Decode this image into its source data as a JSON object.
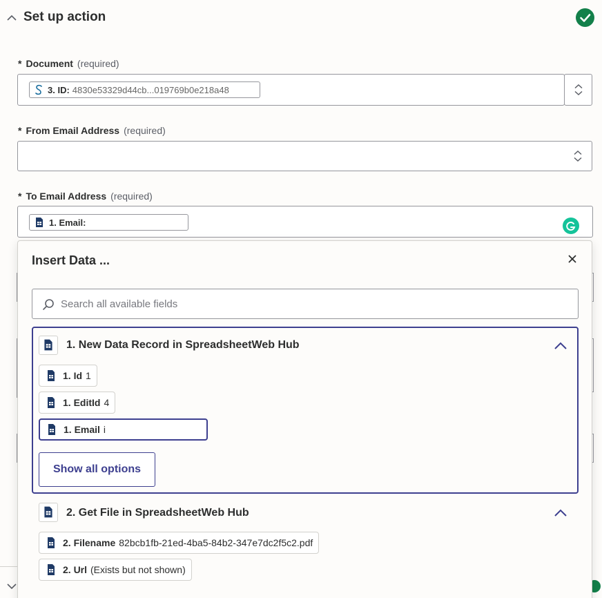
{
  "header": {
    "title": "Set up action",
    "status_color": "#13804a"
  },
  "fields": {
    "document": {
      "star": "*",
      "label": "Document",
      "required": "(required)",
      "pill_key": "3. ID:",
      "pill_value": "4830e53329d44cb...019769b0e218a48"
    },
    "from_email": {
      "star": "*",
      "label": "From Email Address",
      "required": "(required)",
      "value": ""
    },
    "to_email": {
      "star": "*",
      "label": "To Email Address",
      "required": "(required)",
      "pill_key": "1. Email:"
    }
  },
  "popup": {
    "title": "Insert Data ...",
    "search_placeholder": "Search all available fields",
    "groups": [
      {
        "title": "1. New Data Record in SpreadsheetWeb Hub",
        "expanded": true,
        "items": [
          {
            "key": "1. Id",
            "value": "1"
          },
          {
            "key": "1. EditId",
            "value": "4"
          },
          {
            "key": "1. Email",
            "value": "i",
            "selected": true
          }
        ],
        "show_all_label": "Show all options"
      },
      {
        "title": "2. Get File in SpreadsheetWeb Hub",
        "expanded": true,
        "items": [
          {
            "key": "2. Filename",
            "value": "82bcb1fb-21ed-4ba5-84b2-347e7dc2f5c2.pdf"
          },
          {
            "key": "2. Url",
            "value": "(Exists but not shown)"
          }
        ]
      }
    ]
  },
  "colors": {
    "accent": "#3d3f8f",
    "icon_navy": "#1f3a66",
    "grammarly": "#15c39a"
  }
}
